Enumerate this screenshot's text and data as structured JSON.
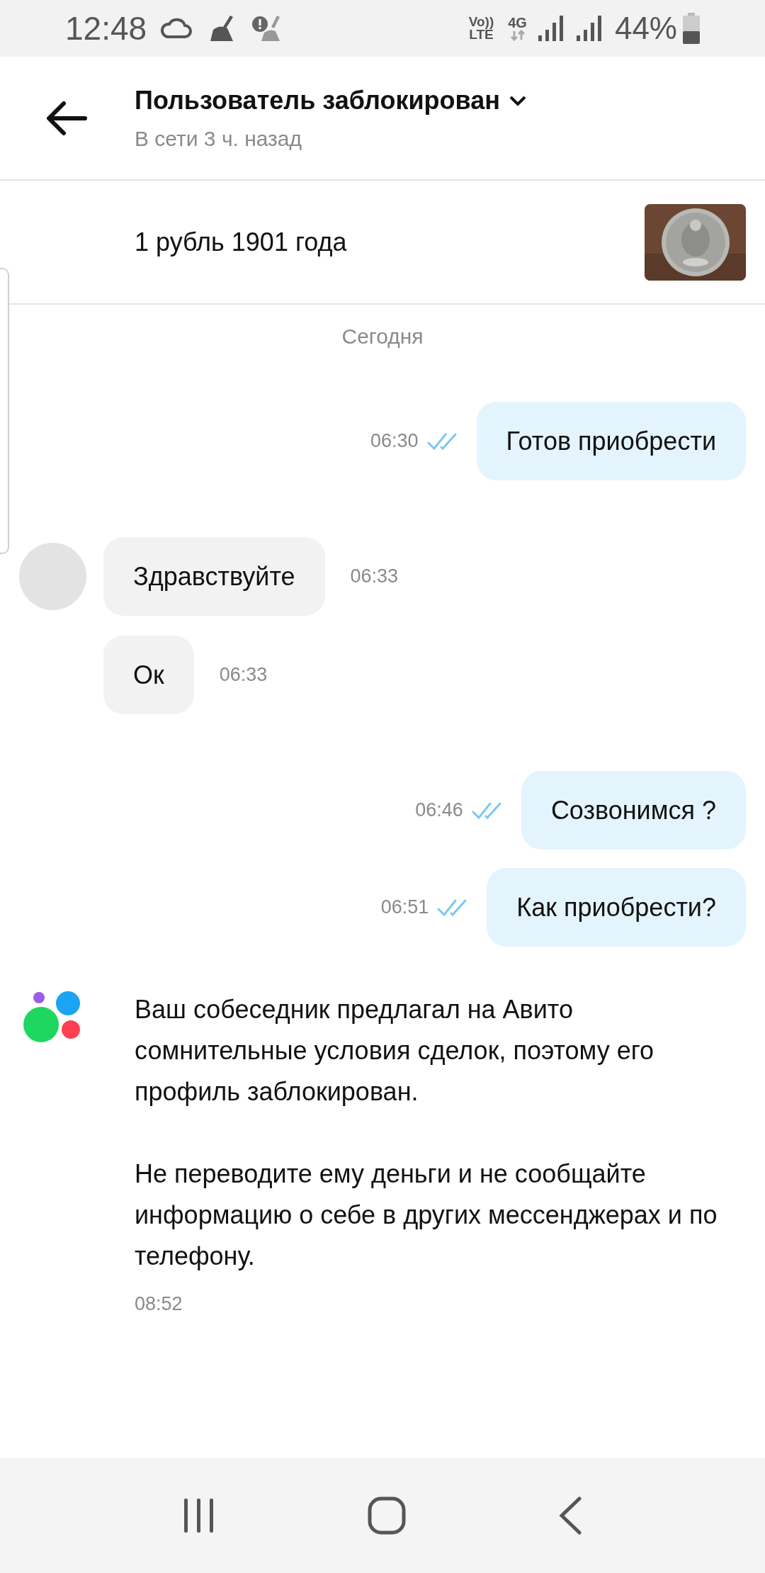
{
  "status_bar": {
    "time": "12:48",
    "network": "4G",
    "volte_top": "Vo))",
    "volte_bottom": "LTE",
    "battery": "44%"
  },
  "header": {
    "title": "Пользователь заблокирован",
    "subtitle": "В сети 3 ч. назад"
  },
  "listing": {
    "title": "1 рубль 1901 года"
  },
  "date_divider": "Сегодня",
  "messages": [
    {
      "kind": "outgoing",
      "text": "Готов приобрести",
      "time": "06:30",
      "read": true
    },
    {
      "kind": "incoming",
      "text": "Здравствуйте",
      "time": "06:33",
      "avatar": true
    },
    {
      "kind": "incoming",
      "text": "Ок",
      "time": "06:33",
      "avatar": false
    },
    {
      "kind": "outgoing",
      "text": "Созвонимся ?",
      "time": "06:46",
      "read": true
    },
    {
      "kind": "outgoing",
      "text": "Как приобрести?",
      "time": "06:51",
      "read": true
    },
    {
      "kind": "system",
      "paragraphs": [
        "Ваш собеседник предлагал на Авито сомнительные условия сделок, поэтому его профиль заблокирован.",
        "Не переводите ему деньги и не сообщайте информацию о себе в других мессенджерах и по телефону."
      ],
      "time": "08:52"
    }
  ]
}
